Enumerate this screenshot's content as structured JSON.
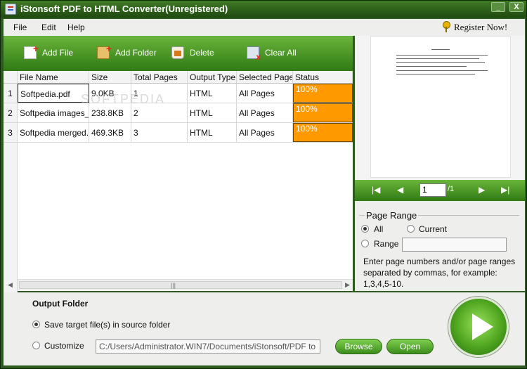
{
  "window": {
    "title": "iStonsoft PDF to HTML Converter(Unregistered)",
    "minimize_symbol": "_",
    "close_symbol": "X"
  },
  "menu": {
    "items": [
      "File",
      "Edit",
      "Help"
    ],
    "register_label": "Register  Now!"
  },
  "toolbar": {
    "add_file": "Add File",
    "add_folder": "Add Folder",
    "delete": "Delete",
    "clear_all": "Clear All"
  },
  "table": {
    "columns": [
      "File Name",
      "Size",
      "Total Pages",
      "Output Type",
      "Selected Page",
      "Status"
    ],
    "rows": [
      {
        "num": "1",
        "file": "Softpedia.pdf",
        "size": "9.0KB",
        "pages": "1",
        "type": "HTML",
        "selected": "All Pages",
        "status": "100%"
      },
      {
        "num": "2",
        "file": "Softpedia images_",
        "size": "238.8KB",
        "pages": "2",
        "type": "HTML",
        "selected": "All Pages",
        "status": "100%"
      },
      {
        "num": "3",
        "file": "Softpedia merged.",
        "size": "469.3KB",
        "pages": "3",
        "type": "HTML",
        "selected": "All Pages",
        "status": "100%"
      }
    ],
    "watermark": "SOFTPEDIA"
  },
  "preview": {
    "current_page": "1",
    "total_pages": "/1"
  },
  "page_range": {
    "title": "Page Range",
    "all_label": "All",
    "current_label": "Current",
    "range_label": "Range",
    "help_text": "Enter page numbers and/or page ranges separated by commas, for example: 1,3,4,5-10.",
    "selected": "All"
  },
  "output": {
    "title": "Output Folder",
    "option_source": "Save target file(s) in source folder",
    "option_custom": "Customize",
    "path": "C:/Users/Administrator.WIN7/Documents/iStonsoft/PDF to",
    "browse": "Browse",
    "open": "Open",
    "selected": "source"
  },
  "colors": {
    "toolbar_green": "#4c9a28",
    "status_orange": "#ff9900",
    "frame_dark_green": "#2d5a1e"
  }
}
